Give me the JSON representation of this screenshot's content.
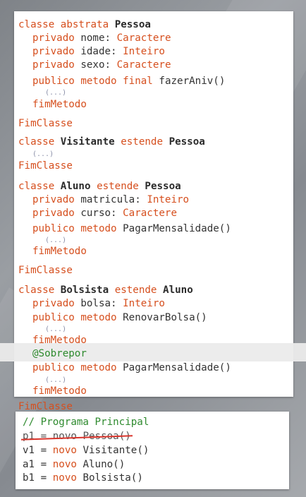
{
  "kw": {
    "classe": "classe",
    "abstrata": "abstrata",
    "privado": "privado",
    "publico": "publico",
    "metodo": "metodo",
    "final": "final",
    "fimMetodo": "fimMetodo",
    "FimClasse": "FimClasse",
    "estende": "estende",
    "novo": "novo"
  },
  "types": {
    "caractere": "Caractere",
    "inteiro": "Inteiro"
  },
  "ellipsis": "(...)",
  "pessoa": {
    "name": "Pessoa",
    "attrs": [
      {
        "name": "nome:",
        "type": "Caractere"
      },
      {
        "name": "idade:",
        "type": "Inteiro"
      },
      {
        "name": "sexo:",
        "type": "Caractere"
      }
    ],
    "method": "fazerAniv()"
  },
  "visitante": {
    "name": "Visitante",
    "parent": "Pessoa"
  },
  "aluno": {
    "name": "Aluno",
    "parent": "Pessoa",
    "attrs": [
      {
        "name": "matricula:",
        "type": "Inteiro"
      },
      {
        "name": "curso:",
        "type": "Caractere"
      }
    ],
    "method": "PagarMensalidade()"
  },
  "bolsista": {
    "name": "Bolsista",
    "parent": "Aluno",
    "attrs": [
      {
        "name": "bolsa:",
        "type": "Inteiro"
      }
    ],
    "method1": "RenovarBolsa()",
    "annotation": "@Sobrepor",
    "method2": "PagarMensalidade()"
  },
  "main": {
    "comment": "// Programa Principal",
    "lines": [
      {
        "var": "p1",
        "eq": "=",
        "cls": "Pessoa()",
        "struck": true
      },
      {
        "var": "v1",
        "eq": "=",
        "cls": "Visitante()"
      },
      {
        "var": "a1",
        "eq": "=",
        "cls": "Aluno()"
      },
      {
        "var": "b1",
        "eq": "=",
        "cls": "Bolsista()"
      }
    ]
  }
}
